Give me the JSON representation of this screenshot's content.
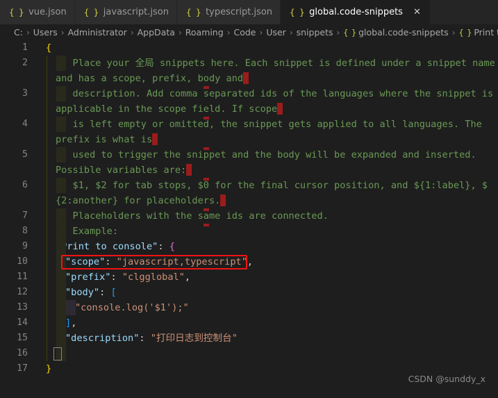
{
  "window": {
    "app": "Visual Studio Code",
    "theme_background": "#1e1e1e",
    "accent_annotation_color": "#f21313"
  },
  "tabs": [
    {
      "icon": "json-braces-icon",
      "label": "vue.json",
      "active": false,
      "closable": false
    },
    {
      "icon": "json-braces-icon",
      "label": "javascript.json",
      "active": false,
      "closable": false
    },
    {
      "icon": "json-braces-icon",
      "label": "typescript.json",
      "active": false,
      "closable": false
    },
    {
      "icon": "json-braces-icon",
      "label": "global.code-snippets",
      "active": true,
      "closable": true,
      "close_glyph": "✕"
    }
  ],
  "breadcrumb": {
    "separator": "›",
    "items": [
      {
        "label": "C:",
        "icon": null
      },
      {
        "label": "Users",
        "icon": null
      },
      {
        "label": "Administrator",
        "icon": null
      },
      {
        "label": "AppData",
        "icon": null
      },
      {
        "label": "Roaming",
        "icon": null
      },
      {
        "label": "Code",
        "icon": null
      },
      {
        "label": "User",
        "icon": null
      },
      {
        "label": "snippets",
        "icon": null
      },
      {
        "label": "global.code-snippets",
        "icon": "{ }"
      },
      {
        "label": "Print to cons",
        "icon": "{ }"
      }
    ]
  },
  "editor": {
    "language": "jsonc",
    "line_numbers": [
      "1",
      "2",
      "3",
      "4",
      "5",
      "6",
      "7",
      "8",
      "9",
      "10",
      "11",
      "12",
      "13",
      "14",
      "15",
      "16",
      "17"
    ],
    "lines": [
      {
        "num": "1",
        "segments": [
          {
            "t": "{",
            "c": "brkt1"
          }
        ]
      },
      {
        "num": "2",
        "segments": [
          {
            "t": "// Place your 全局 snippets here. Each snippet is defined under a snippet name",
            "c": "cmt"
          }
        ],
        "wrap": [
          {
            "t": "and has a scope, prefix, body and",
            "c": "cmt"
          }
        ],
        "wrap_marker": true
      },
      {
        "num": "3",
        "segments": [
          {
            "t": "// description. Add comma separated ids of the languages where the snippet is",
            "c": "cmt"
          }
        ],
        "wrap": [
          {
            "t": "applicable in the scope field. If scope",
            "c": "cmt"
          }
        ],
        "wrap_marker": true
      },
      {
        "num": "4",
        "segments": [
          {
            "t": "// is left empty or omitted, the snippet gets applied to all languages. The",
            "c": "cmt"
          }
        ],
        "wrap": [
          {
            "t": "prefix is what is",
            "c": "cmt"
          }
        ],
        "wrap_marker": true
      },
      {
        "num": "5",
        "segments": [
          {
            "t": "// used to trigger the snippet and the body will be expanded and inserted.",
            "c": "cmt"
          }
        ],
        "wrap": [
          {
            "t": "Possible variables are:",
            "c": "cmt"
          }
        ],
        "wrap_marker": true
      },
      {
        "num": "6",
        "segments": [
          {
            "t": "// $1, $2 for tab stops, $0 for the final cursor position, and ${1:label}, $",
            "c": "cmt"
          }
        ],
        "wrap": [
          {
            "t": "{2:another} for placeholders.",
            "c": "cmt"
          }
        ],
        "wrap_marker": true
      },
      {
        "num": "7",
        "segments": [
          {
            "t": "// Placeholders with the same ids are connected.",
            "c": "cmt"
          }
        ]
      },
      {
        "num": "8",
        "segments": [
          {
            "t": "// Example:",
            "c": "cmt"
          }
        ]
      },
      {
        "num": "9",
        "segments": [
          {
            "t": "\"Print to console\"",
            "c": "key"
          },
          {
            "t": ": ",
            "c": "punc"
          },
          {
            "t": "{",
            "c": "brkt2"
          }
        ]
      },
      {
        "num": "10",
        "highlighted": true,
        "segments": [
          {
            "t": "\"scope\"",
            "c": "key"
          },
          {
            "t": ": ",
            "c": "punc"
          },
          {
            "t": "\"javascript,typescript\"",
            "c": "str"
          },
          {
            "t": ",",
            "c": "punc"
          }
        ]
      },
      {
        "num": "11",
        "segments": [
          {
            "t": "\"prefix\"",
            "c": "key"
          },
          {
            "t": ": ",
            "c": "punc"
          },
          {
            "t": "\"clgglobal\"",
            "c": "str"
          },
          {
            "t": ",",
            "c": "punc"
          }
        ]
      },
      {
        "num": "12",
        "segments": [
          {
            "t": "\"body\"",
            "c": "key"
          },
          {
            "t": ": ",
            "c": "punc"
          },
          {
            "t": "[",
            "c": "brkt3"
          }
        ]
      },
      {
        "num": "13",
        "segments": [
          {
            "t": "\"console.log('$1');\"",
            "c": "str"
          }
        ]
      },
      {
        "num": "14",
        "segments": [
          {
            "t": "]",
            "c": "brkt3"
          },
          {
            "t": ",",
            "c": "punc"
          }
        ]
      },
      {
        "num": "15",
        "segments": [
          {
            "t": "\"description\"",
            "c": "key"
          },
          {
            "t": ": ",
            "c": "punc"
          },
          {
            "t": "\"打印日志到控制台\"",
            "c": "str"
          }
        ]
      },
      {
        "num": "16",
        "bracket_match": true,
        "segments": [
          {
            "t": "}",
            "c": "brkt2"
          }
        ]
      },
      {
        "num": "17",
        "segments": [
          {
            "t": "}",
            "c": "brkt1"
          }
        ]
      }
    ]
  },
  "annotation": {
    "type": "red-rectangle",
    "target_line": "10",
    "color": "#f21313"
  },
  "watermark": {
    "text": "CSDN @sunddy_x"
  }
}
